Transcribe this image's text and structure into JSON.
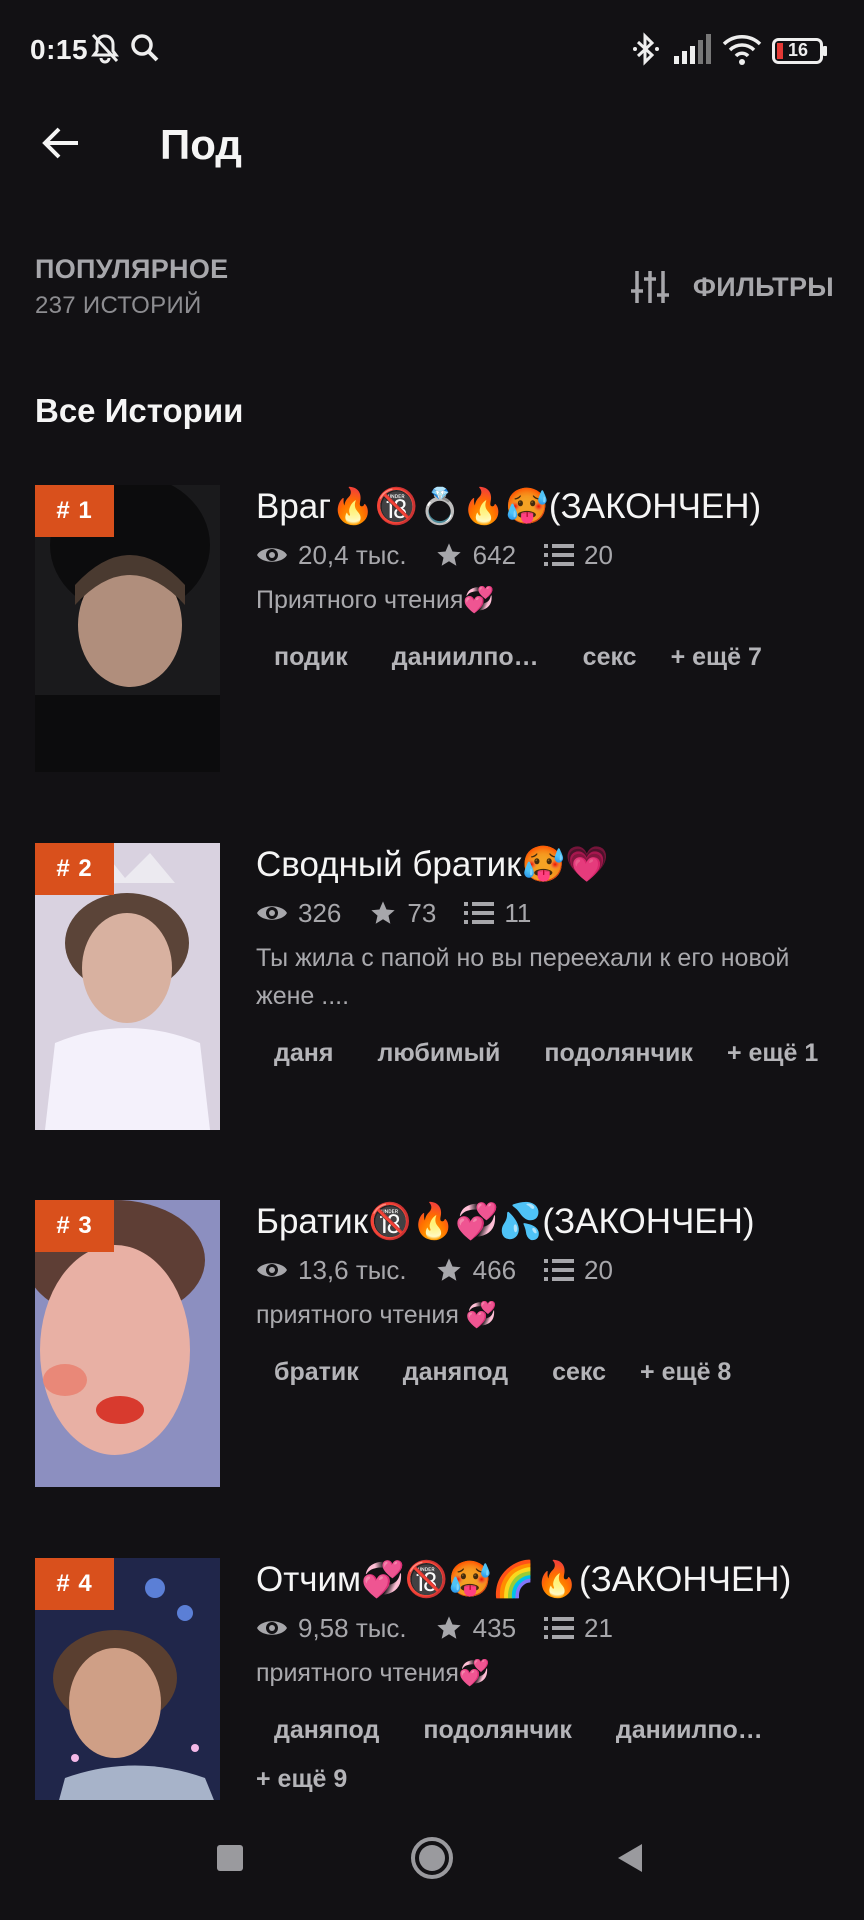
{
  "status_bar": {
    "time": "0:15",
    "battery": "16",
    "icons": [
      "mute-bell-icon",
      "search-icon",
      "bluetooth-icon",
      "signal-icon",
      "wifi-icon",
      "battery-icon"
    ]
  },
  "app_bar": {
    "title": "Под",
    "back_icon": "arrow-left-icon"
  },
  "sort": {
    "title": "ПОПУЛЯРНОЕ",
    "count": "237 ИСТОРИЙ",
    "filters_label": "ФИЛЬТРЫ",
    "filters_icon": "sliders-icon"
  },
  "section_title": "Все Истории",
  "colors": {
    "background": "#121114",
    "accent": "#d9501c",
    "text_primary": "#f5f5f5",
    "text_secondary": "#a7a7ab"
  },
  "stories": [
    {
      "rank": "# 1",
      "title": "Враг🔥🔞💍🔥🥵(ЗАКОНЧЕН)",
      "views": "20,4 тыс.",
      "votes": "642",
      "parts": "20",
      "description": "Приятного чтения💞",
      "tags": [
        "подик",
        "даниилпо…",
        "секс"
      ],
      "more": "+ ещё 7"
    },
    {
      "rank": "# 2",
      "title": "Сводный братик🥵💗",
      "views": "326",
      "votes": "73",
      "parts": "11",
      "description": "Ты жила с папой но вы переехали к его новой жене ....",
      "tags": [
        "даня",
        "любимый",
        "подолянчик"
      ],
      "more": "+ ещё 1"
    },
    {
      "rank": "# 3",
      "title": "Братик🔞🔥💞💦(ЗАКОНЧЕН)",
      "views": "13,6 тыс.",
      "votes": "466",
      "parts": "20",
      "description": "приятного чтения 💞",
      "tags": [
        "братик",
        "даняпод",
        "секс"
      ],
      "more": "+ ещё 8"
    },
    {
      "rank": "# 4",
      "title": "Отчим💞🔞🥵🌈🔥(ЗАКОНЧЕН)",
      "views": "9,58 тыс.",
      "votes": "435",
      "parts": "21",
      "description": "приятного чтения💞",
      "tags": [
        "даняпод",
        "подолянчик",
        "даниилпо…"
      ],
      "more": "+ ещё 9"
    }
  ],
  "nav_bar": {
    "icons": [
      "recents-square-icon",
      "home-circle-icon",
      "back-triangle-icon"
    ]
  }
}
